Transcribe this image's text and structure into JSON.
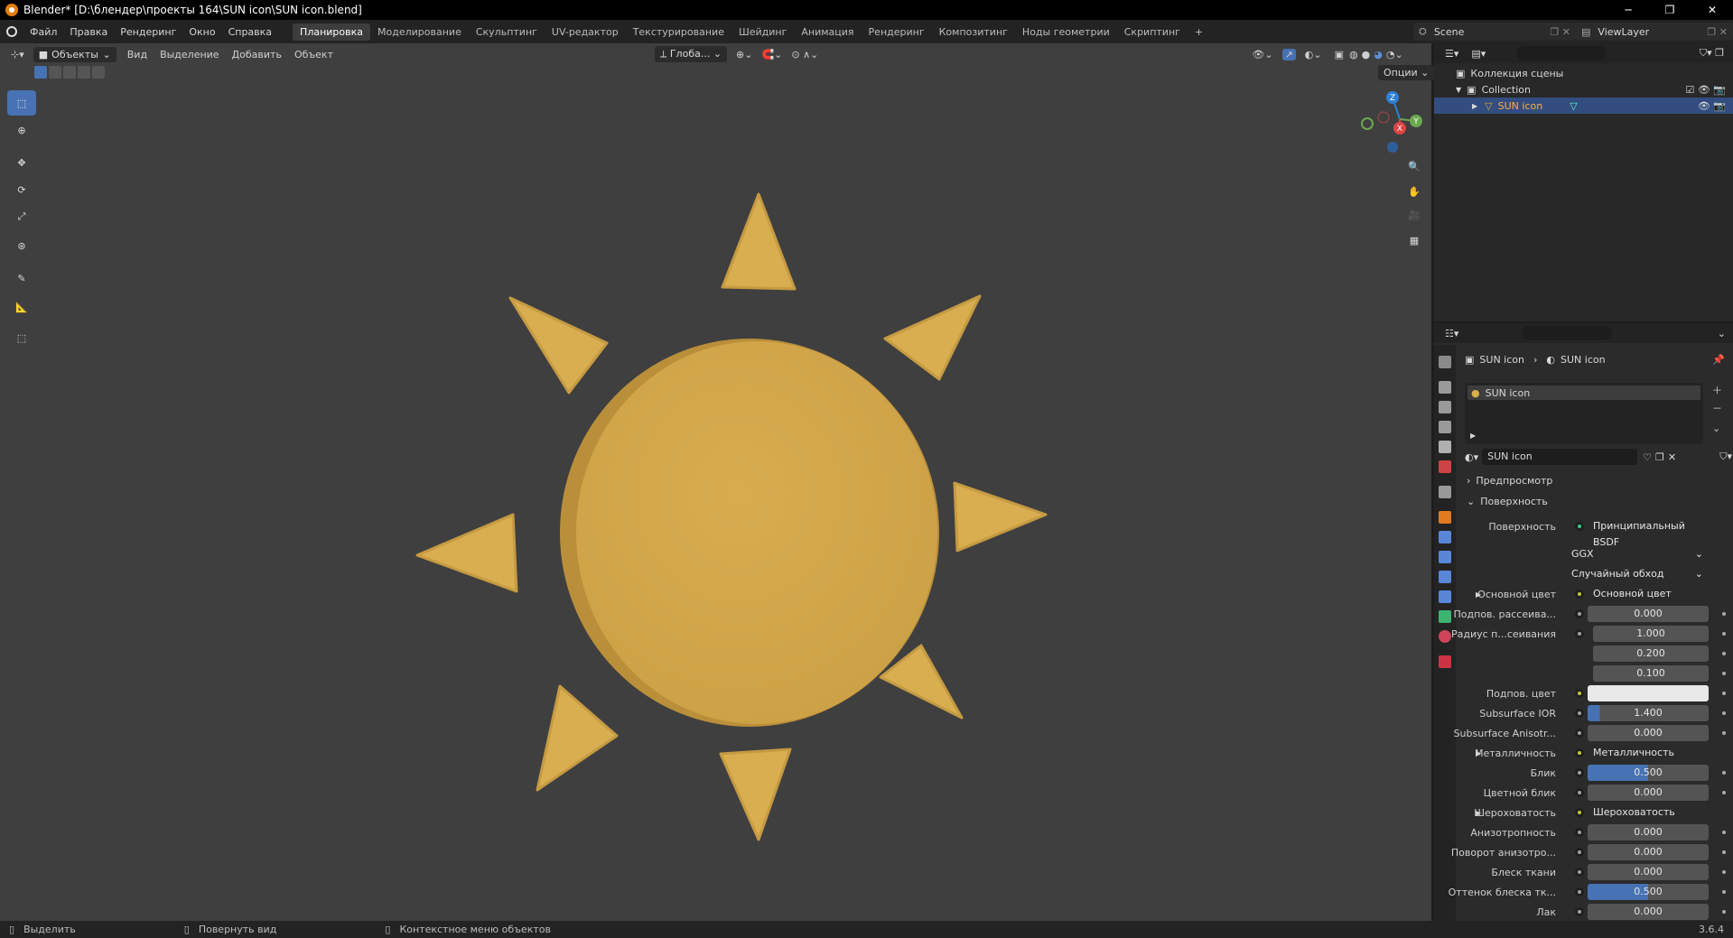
{
  "window": {
    "title": "Blender* [D:\\блендер\\проекты 164\\SUN icon\\SUN icon.blend]",
    "minimize": "─",
    "maximize": "❐",
    "close": "✕"
  },
  "menus": [
    "Файл",
    "Правка",
    "Рендеринг",
    "Окно",
    "Справка"
  ],
  "workspaces": [
    "Планировка",
    "Моделирование",
    "Скульптинг",
    "UV-редактор",
    "Текстурирование",
    "Шейдинг",
    "Анимация",
    "Рендеринг",
    "Композитинг",
    "Ноды геометрии",
    "Скриптинг"
  ],
  "active_workspace": "Планировка",
  "add_workspace": "+",
  "scene": "Scene",
  "viewlayer": "ViewLayer",
  "viewport": {
    "mode": "Объекты",
    "menu": [
      "Вид",
      "Выделение",
      "Добавить",
      "Объект"
    ],
    "orientation": "Глоба...",
    "options": "Опции",
    "gizmo_labels": {
      "z": "Z",
      "y": "Y",
      "x": "X"
    }
  },
  "outliner": {
    "root": "Коллекция сцены",
    "collection": "Collection",
    "object": "SUN icon"
  },
  "properties": {
    "breadcrumb_object": "SUN icon",
    "breadcrumb_material": "SUN icon",
    "slot": "SUN icon",
    "material_name": "SUN icon",
    "panel_preview": "Предпросмотр",
    "panel_surface": "Поверхность",
    "surface_label": "Поверхность",
    "surface_value": "Принципиальный BSDF",
    "distribution": "GGX",
    "subsurface_method": "Случайный обход",
    "rows": [
      {
        "label": "Основной цвет",
        "value": "Основной цвет",
        "kind": "link",
        "expand": true
      },
      {
        "label": "Подпов. рассеива...",
        "value": "0.000",
        "kind": "num"
      },
      {
        "label": "Радиус п...сеивания",
        "value": "1.000",
        "kind": "num"
      },
      {
        "label": "",
        "value": "0.200",
        "kind": "num"
      },
      {
        "label": "",
        "value": "0.100",
        "kind": "num"
      },
      {
        "label": "Подпов. цвет",
        "value": "",
        "kind": "color"
      },
      {
        "label": "Subsurface IOR",
        "value": "1.400",
        "kind": "slider",
        "fill": 0.1
      },
      {
        "label": "Subsurface Anisotr...",
        "value": "0.000",
        "kind": "num"
      },
      {
        "label": "Металличность",
        "value": "Металличность",
        "kind": "link",
        "expand": true
      },
      {
        "label": "Блик",
        "value": "0.500",
        "kind": "slider",
        "fill": 0.5
      },
      {
        "label": "Цветной блик",
        "value": "0.000",
        "kind": "num"
      },
      {
        "label": "Шероховатость",
        "value": "Шероховатость",
        "kind": "link",
        "expand": true
      },
      {
        "label": "Анизотропность",
        "value": "0.000",
        "kind": "num"
      },
      {
        "label": "Поворот анизотро...",
        "value": "0.000",
        "kind": "num"
      },
      {
        "label": "Блеск ткани",
        "value": "0.000",
        "kind": "num"
      },
      {
        "label": "Оттенок блеска тк...",
        "value": "0.500",
        "kind": "slider",
        "fill": 0.5
      },
      {
        "label": "Лак",
        "value": "0.000",
        "kind": "num"
      }
    ]
  },
  "status": {
    "select": "Выделить",
    "rotate": "Повернуть вид",
    "context": "Контекстное меню объектов",
    "version": "3.6.4"
  },
  "colors": {
    "sun": "#d9ae4f",
    "viewport_bg": "#3f3f3f",
    "accent": "#4772b3"
  }
}
